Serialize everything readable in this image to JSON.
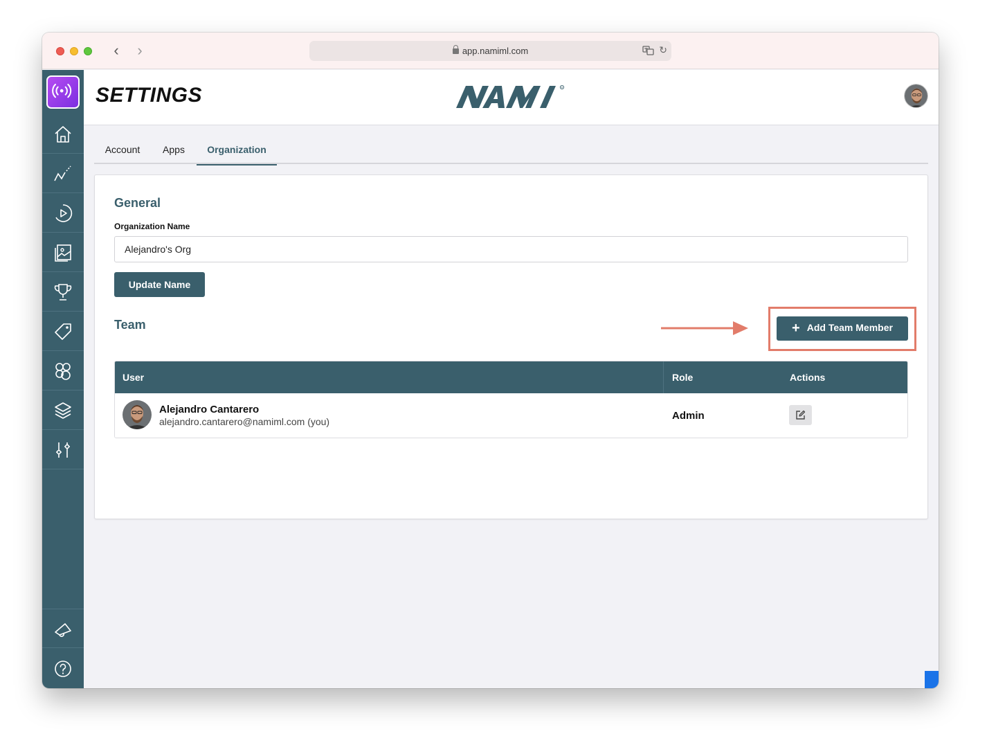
{
  "browser": {
    "url": "app.namiml.com",
    "icons": [
      "back-icon",
      "forward-icon",
      "lock-icon",
      "translate-icon",
      "reload-icon"
    ]
  },
  "sidebar": {
    "logo_icon": "broadcast-icon",
    "items": [
      {
        "icon": "home-icon"
      },
      {
        "icon": "analytics-icon"
      },
      {
        "icon": "play-icon"
      },
      {
        "icon": "gallery-icon"
      },
      {
        "icon": "trophy-icon"
      },
      {
        "icon": "tag-icon"
      },
      {
        "icon": "segments-icon"
      },
      {
        "icon": "layers-icon"
      },
      {
        "icon": "sliders-icon"
      }
    ],
    "bottom_items": [
      {
        "icon": "megaphone-icon"
      },
      {
        "icon": "help-icon"
      }
    ]
  },
  "header": {
    "title": "SETTINGS",
    "brand": "NAMI"
  },
  "tabs": [
    {
      "label": "Account",
      "active": false
    },
    {
      "label": "Apps",
      "active": false
    },
    {
      "label": "Organization",
      "active": true
    }
  ],
  "general": {
    "title": "General",
    "org_name_label": "Organization Name",
    "org_name_value": "Alejandro's Org",
    "update_button": "Update Name"
  },
  "team": {
    "title": "Team",
    "add_button": "Add Team Member",
    "columns": [
      "User",
      "Role",
      "Actions"
    ],
    "members": [
      {
        "name": "Alejandro Cantarero",
        "email": "alejandro.cantarero@namiml.com (you)",
        "role": "Admin"
      }
    ]
  },
  "colors": {
    "primary": "#3a5f6c",
    "highlight": "#e27c6a",
    "chat": "#1a73e8"
  }
}
